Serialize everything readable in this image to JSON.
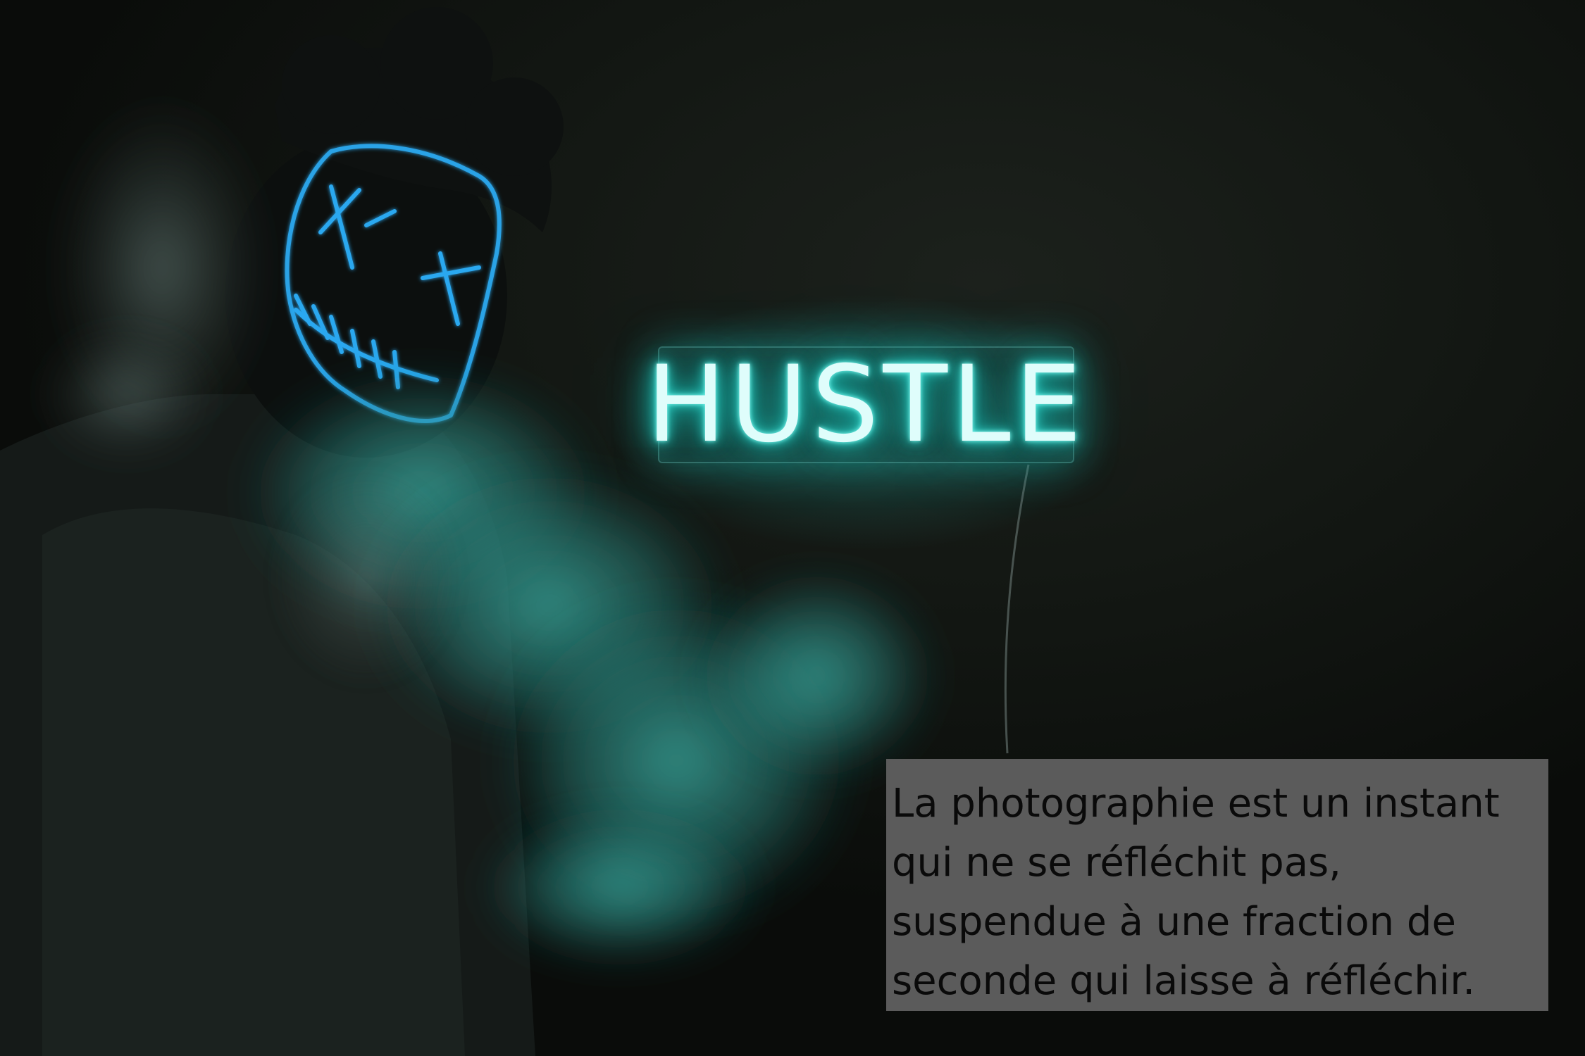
{
  "photo": {
    "subject": "masked-person-with-smoke",
    "accent_color": "#2fd6cc",
    "mask_color": "#2aa8f0",
    "background_color": "#121612"
  },
  "sign": {
    "text": "HUSTLE",
    "glow_color": "#3fe3d8"
  },
  "caption": {
    "lines": [
      "La photographie est un instant",
      "qui ne se réfléchit pas,",
      "suspendue à une fraction de",
      "seconde qui laisse à réfléchir."
    ],
    "box_color": "#5b5b5b",
    "text_color": "#0a0a0a"
  }
}
